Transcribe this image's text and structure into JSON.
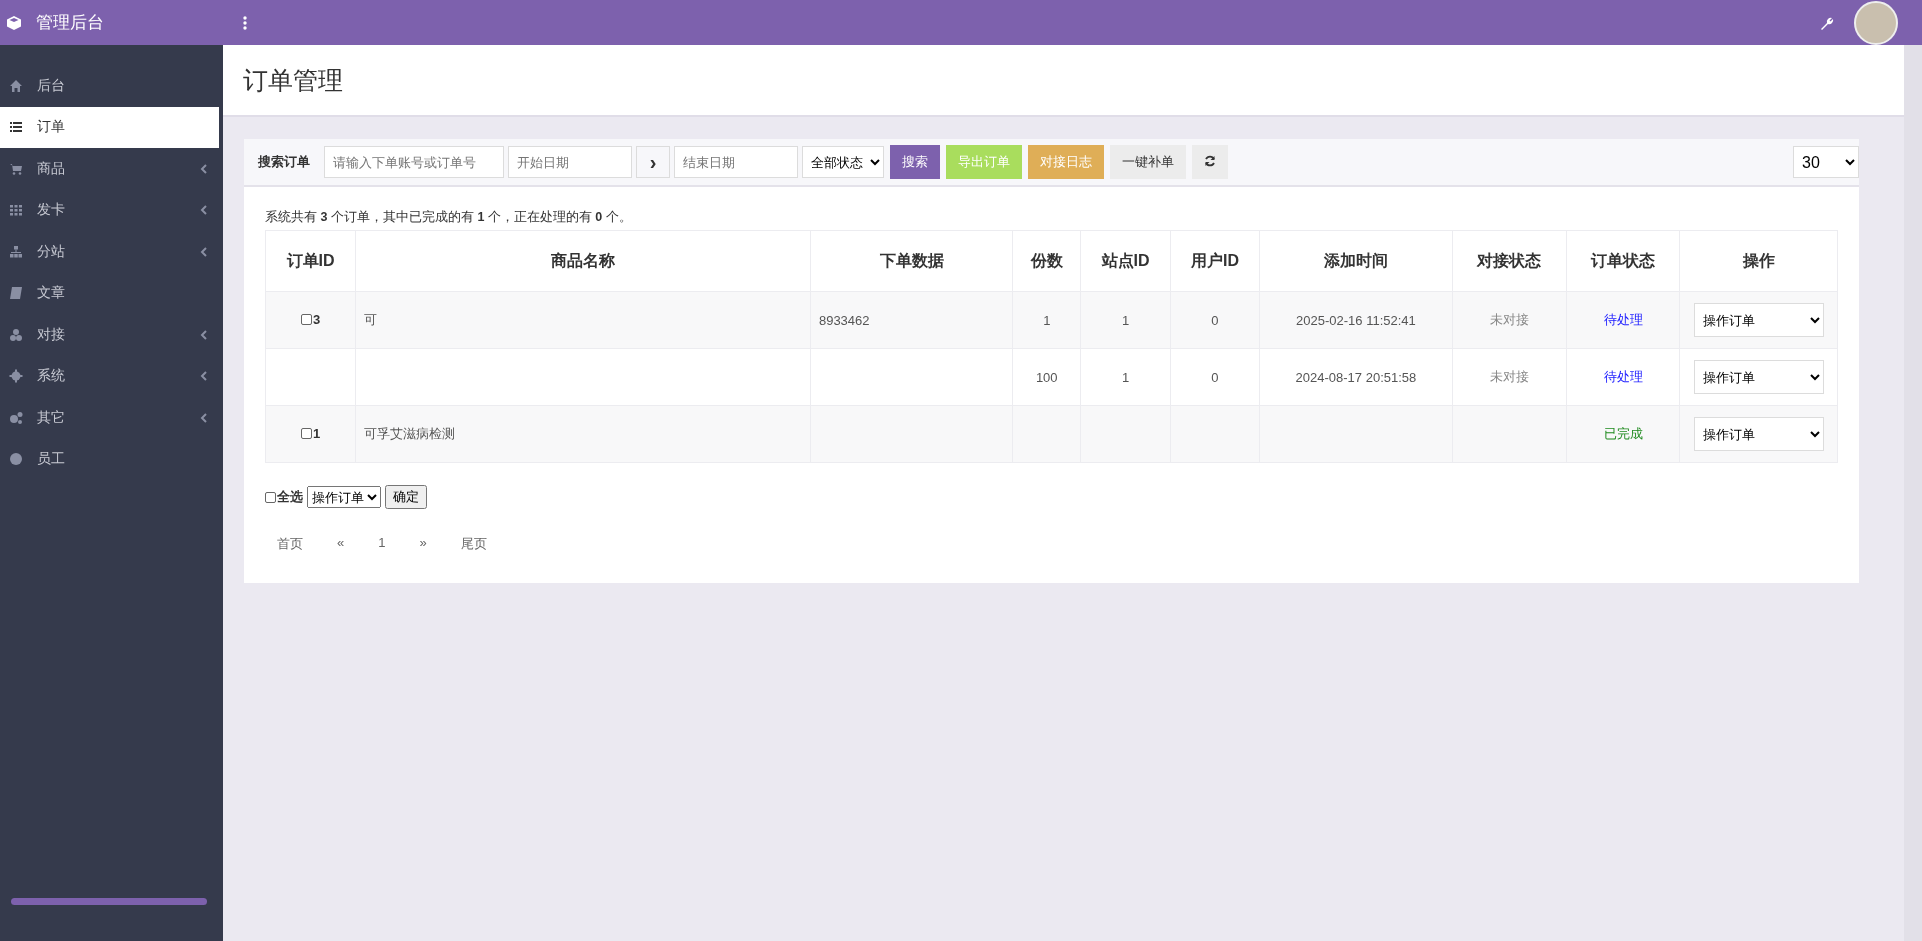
{
  "brand": {
    "title": "管理后台"
  },
  "sidebar": {
    "items": [
      {
        "label": "后台",
        "selected": false,
        "expandable": false
      },
      {
        "label": "订单",
        "selected": true,
        "expandable": false
      },
      {
        "label": "商品",
        "selected": false,
        "expandable": true
      },
      {
        "label": "发卡",
        "selected": false,
        "expandable": true
      },
      {
        "label": "分站",
        "selected": false,
        "expandable": true
      },
      {
        "label": "文章",
        "selected": false,
        "expandable": false
      },
      {
        "label": "对接",
        "selected": false,
        "expandable": true
      },
      {
        "label": "系统",
        "selected": false,
        "expandable": true
      },
      {
        "label": "其它",
        "selected": false,
        "expandable": true
      },
      {
        "label": "员工",
        "selected": false,
        "expandable": false
      }
    ]
  },
  "page_title": "订单管理",
  "toolbar": {
    "label": "搜索订单",
    "search": {
      "placeholder": "请输入下单账号或订单号"
    },
    "start_date": {
      "placeholder": "开始日期"
    },
    "arrow": "›",
    "end_date": {
      "placeholder": "结束日期"
    },
    "status_select": "全部状态",
    "buttons": [
      {
        "label": "搜索",
        "kind": "primary"
      },
      {
        "label": "导出订单",
        "kind": "success"
      },
      {
        "label": "对接日志",
        "kind": "warning"
      },
      {
        "label": "一键补单",
        "kind": "default"
      }
    ],
    "page_size": "30"
  },
  "summary": "系统共有 **3** 个订单，其中已完成的有 **1** 个，正在处理的有 **0** 个。",
  "table": {
    "columns": [
      "订单ID",
      "商品名称",
      "下单数据",
      "份数",
      "站点ID",
      "用户ID",
      "添加时间",
      "对接状态",
      "订单状态",
      "操作"
    ],
    "rows": [
      {
        "id": "3",
        "checked": false,
        "name": "可",
        "data": "8933462",
        "qty": "1",
        "site": "1",
        "user": "0",
        "time": "2025-02-16 11:52:41",
        "link_status": "未对接",
        "status": {
          "text": "待处理",
          "kind": "pending"
        },
        "action": "操作订单"
      },
      {
        "qty": "100",
        "site": "1",
        "user": "0",
        "time": "2024-08-17 20:51:58",
        "link_status": "未对接",
        "status": {
          "text": "待处理",
          "kind": "pending"
        },
        "action": "操作订单"
      },
      {
        "id": "1",
        "checked": false,
        "name": "可孚艾滋病检测",
        "status": {
          "text": "已完成",
          "kind": "done"
        },
        "action": "操作订单"
      }
    ]
  },
  "bulk": {
    "select_all": "全选",
    "checked": false,
    "action": "操作订单",
    "confirm": "确定"
  },
  "pagination": [
    "首页",
    "«",
    "1",
    "»",
    "尾页"
  ]
}
